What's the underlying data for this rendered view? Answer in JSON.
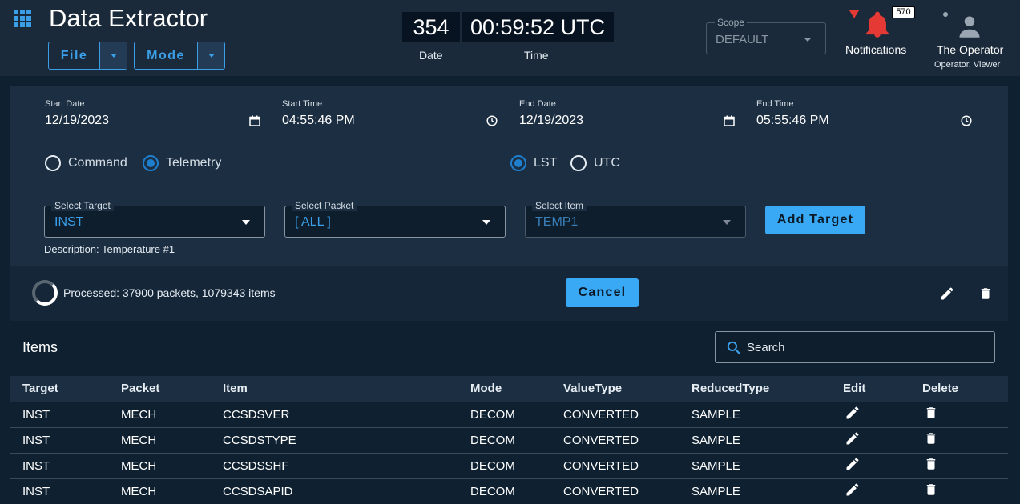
{
  "header": {
    "app_title": "Data Extractor",
    "file_label": "File",
    "mode_label": "Mode",
    "day_value": "354",
    "day_label": "Date",
    "time_value": "00:59:52 UTC",
    "time_label": "Time",
    "scope_label": "Scope",
    "scope_value": "DEFAULT",
    "notifications_count": "570",
    "notifications_label": "Notifications",
    "user_name": "The Operator",
    "user_roles": "Operator, Viewer"
  },
  "filters": {
    "start_date_label": "Start Date",
    "start_date": "12/19/2023",
    "start_time_label": "Start Time",
    "start_time": "04:55:46 PM",
    "end_date_label": "End Date",
    "end_date": "12/19/2023",
    "end_time_label": "End Time",
    "end_time": "05:55:46 PM",
    "radio_command": "Command",
    "radio_telemetry": "Telemetry",
    "radio_lst": "LST",
    "radio_utc": "UTC",
    "target_label": "Select Target",
    "target_value": "INST",
    "packet_label": "Select Packet",
    "packet_value": "[ ALL ]",
    "item_label": "Select Item",
    "item_value": "TEMP1",
    "add_target_label": "Add Target",
    "description": "Description: Temperature #1"
  },
  "progress": {
    "text": "Processed: 37900 packets, 1079343 items",
    "cancel_label": "Cancel"
  },
  "items": {
    "title": "Items",
    "search_placeholder": "Search",
    "columns": [
      "Target",
      "Packet",
      "Item",
      "Mode",
      "ValueType",
      "ReducedType",
      "Edit",
      "Delete"
    ],
    "rows": [
      [
        "INST",
        "MECH",
        "CCSDSVER",
        "DECOM",
        "CONVERTED",
        "SAMPLE"
      ],
      [
        "INST",
        "MECH",
        "CCSDSTYPE",
        "DECOM",
        "CONVERTED",
        "SAMPLE"
      ],
      [
        "INST",
        "MECH",
        "CCSDSSHF",
        "DECOM",
        "CONVERTED",
        "SAMPLE"
      ],
      [
        "INST",
        "MECH",
        "CCSDSAPID",
        "DECOM",
        "CONVERTED",
        "SAMPLE"
      ]
    ]
  },
  "colors": {
    "accent": "#3aa9f5",
    "background": "#0f2131",
    "panel": "#1c2e42",
    "alert": "#e53935"
  },
  "icons": {
    "apps": "grid-icon",
    "calendar": "calendar-icon",
    "clock": "clock-icon",
    "bell": "bell-icon",
    "user": "account-icon",
    "search": "search-icon",
    "edit": "pencil-icon",
    "delete": "trash-icon"
  }
}
